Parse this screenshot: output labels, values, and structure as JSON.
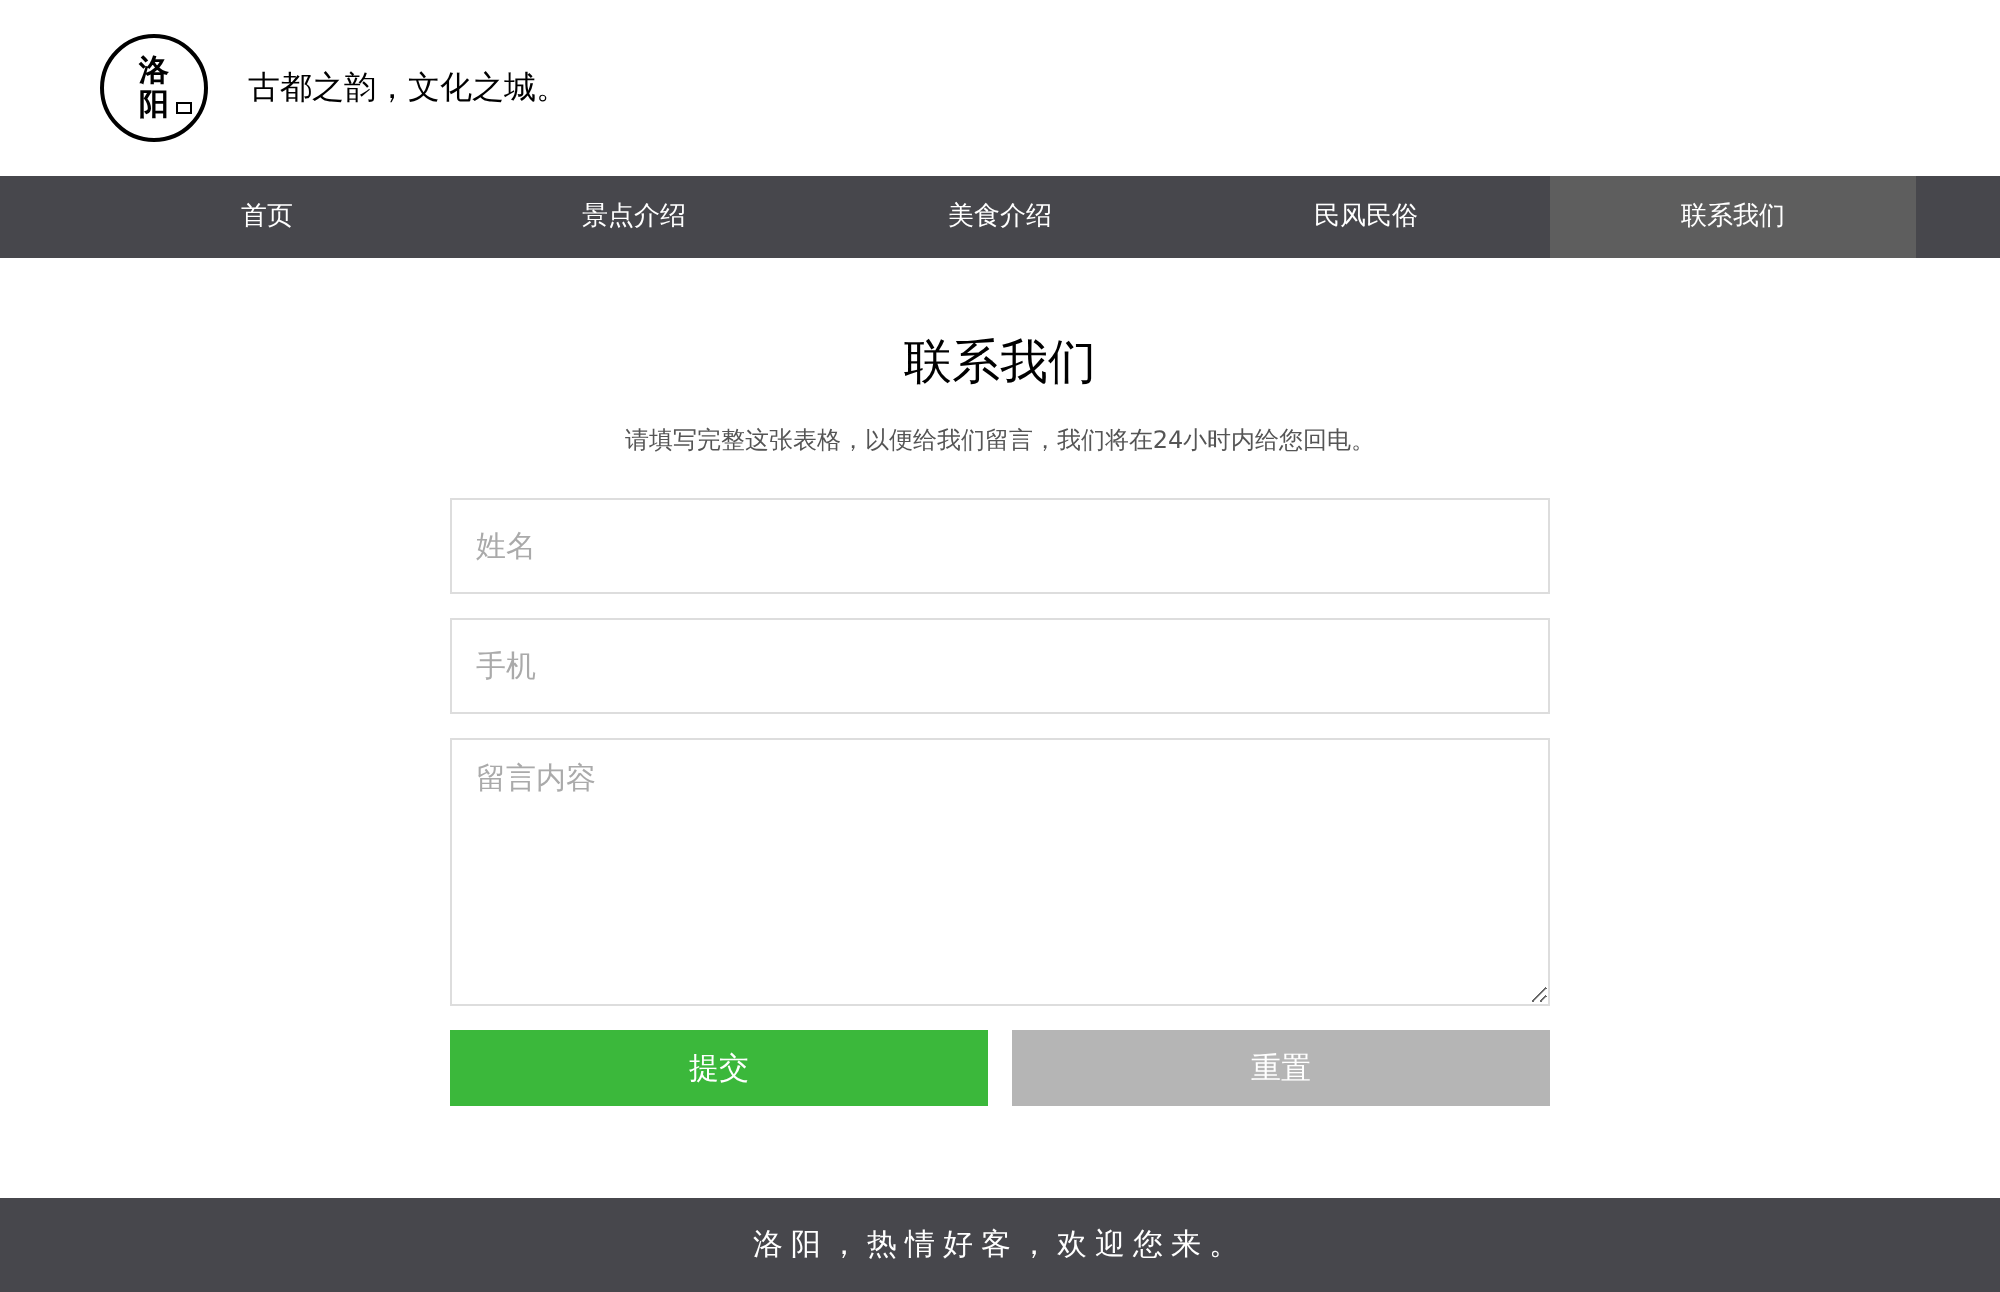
{
  "header": {
    "logo": [
      "洛",
      "阳"
    ],
    "slogan": "古都之韵，文化之城。"
  },
  "nav": [
    {
      "label": "首页",
      "selected": false
    },
    {
      "label": "景点介绍",
      "selected": false
    },
    {
      "label": "美食介绍",
      "selected": false
    },
    {
      "label": "民风民俗",
      "selected": false
    },
    {
      "label": "联系我们",
      "selected": true
    }
  ],
  "contact": {
    "title": "联系我们",
    "subtitle": "请填写完整这张表格，以便给我们留言，我们将在24小时内给您回电。",
    "fields": [
      {
        "kind": "input",
        "placeholder": "姓名"
      },
      {
        "kind": "input",
        "placeholder": "手机"
      },
      {
        "kind": "textarea",
        "placeholder": "留言内容"
      }
    ],
    "buttons": [
      {
        "kind": "submit",
        "label": "提交"
      },
      {
        "kind": "reset",
        "label": "重置"
      }
    ]
  },
  "footer": "洛阳，热情好客，欢迎您来。"
}
